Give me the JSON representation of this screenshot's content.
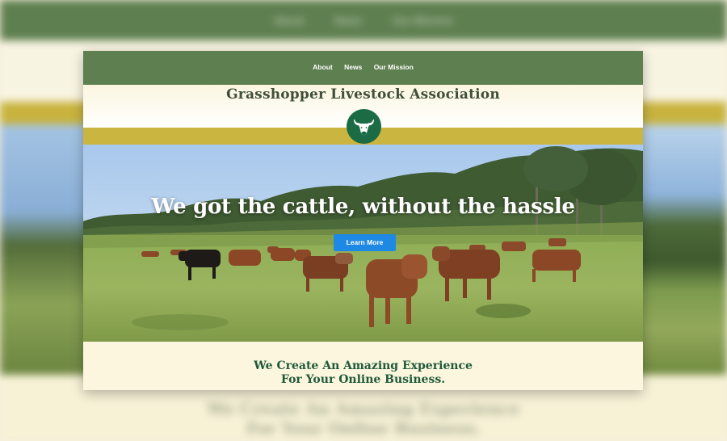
{
  "nav": {
    "items": [
      {
        "label": "About"
      },
      {
        "label": "News"
      },
      {
        "label": "Our Mission"
      }
    ]
  },
  "site": {
    "title": "Grasshopper Livestock Association",
    "logo_icon": "bull-head-icon"
  },
  "hero": {
    "headline": "We got the cattle, without the hassle",
    "button_label": "Learn More",
    "image_icon": "cattle-pasture-image"
  },
  "section": {
    "tagline_line1": "We Create An Amazing Experience",
    "tagline_line2": "For Your Online Business."
  },
  "colors": {
    "nav_green": "#5e7f50",
    "gold": "#c9b53f",
    "cream": "#fbf6df",
    "button_blue": "#1e88e5",
    "tagline_green": "#1f5a3a",
    "logo_green": "#1b6b45"
  }
}
